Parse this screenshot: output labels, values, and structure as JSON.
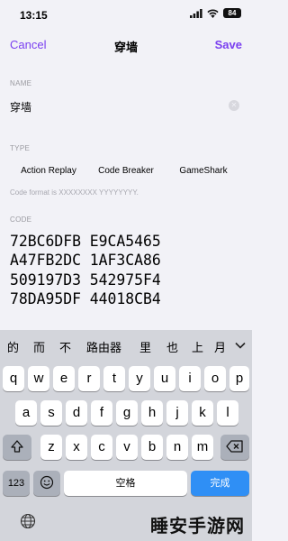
{
  "status": {
    "time": "13:15",
    "battery": "84"
  },
  "nav": {
    "cancel": "Cancel",
    "title": "穿墙",
    "save": "Save"
  },
  "name_section": {
    "label": "NAME",
    "value": "穿墙"
  },
  "type_section": {
    "label": "TYPE",
    "options": [
      "Action Replay",
      "Code Breaker",
      "GameShark"
    ],
    "hint": "Code format is XXXXXXXX YYYYYYYY."
  },
  "code_section": {
    "label": "CODE",
    "lines": [
      "72BC6DFB E9CA5465",
      "A47FB2DC 1AF3CA86",
      "509197D3 542975F4",
      "78DA95DF 44018CB4"
    ]
  },
  "keyboard": {
    "candidates": [
      "的",
      "而",
      "不",
      "路由器",
      "里",
      "也",
      "上",
      "月"
    ],
    "row1": [
      "q",
      "w",
      "e",
      "r",
      "t",
      "y",
      "u",
      "i",
      "o",
      "p"
    ],
    "row2": [
      "a",
      "s",
      "d",
      "f",
      "g",
      "h",
      "j",
      "k",
      "l"
    ],
    "row3": [
      "z",
      "x",
      "c",
      "v",
      "b",
      "n",
      "m"
    ],
    "numbers_key": "123",
    "space_label": "空格",
    "done_label": "完成",
    "icons": {
      "shift": "shift-icon",
      "delete": "delete-icon",
      "emoji": "emoji-icon",
      "globe": "globe-icon",
      "chevron": "chevron-down-icon"
    }
  },
  "watermark": "睡安手游网"
}
